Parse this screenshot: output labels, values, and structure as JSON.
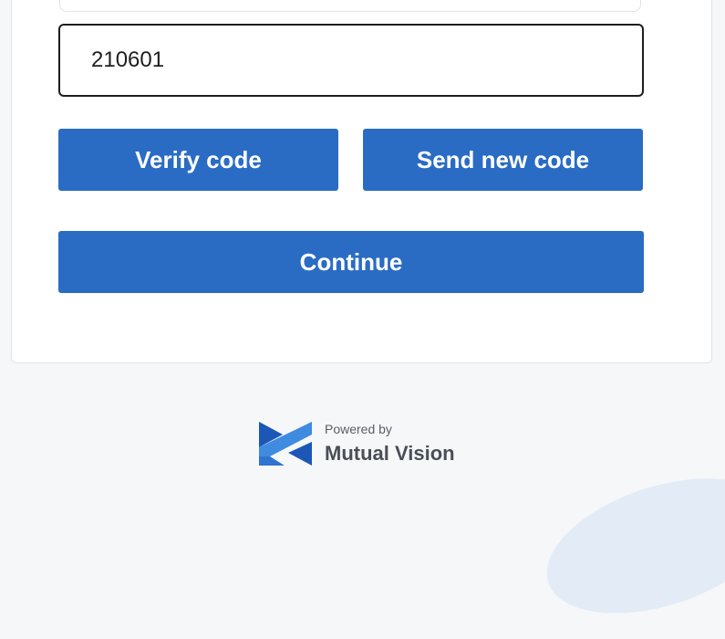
{
  "form": {
    "code_value": "210601",
    "verify_label": "Verify code",
    "resend_label": "Send new code",
    "continue_label": "Continue"
  },
  "footer": {
    "powered_by": "Powered by",
    "brand": "Mutual Vision"
  },
  "colors": {
    "primary": "#2a6cc4",
    "logo_light": "#3f8be0",
    "logo_dark": "#1c57b8"
  },
  "icons": {
    "logo": "mutual-vision-logo-icon"
  }
}
